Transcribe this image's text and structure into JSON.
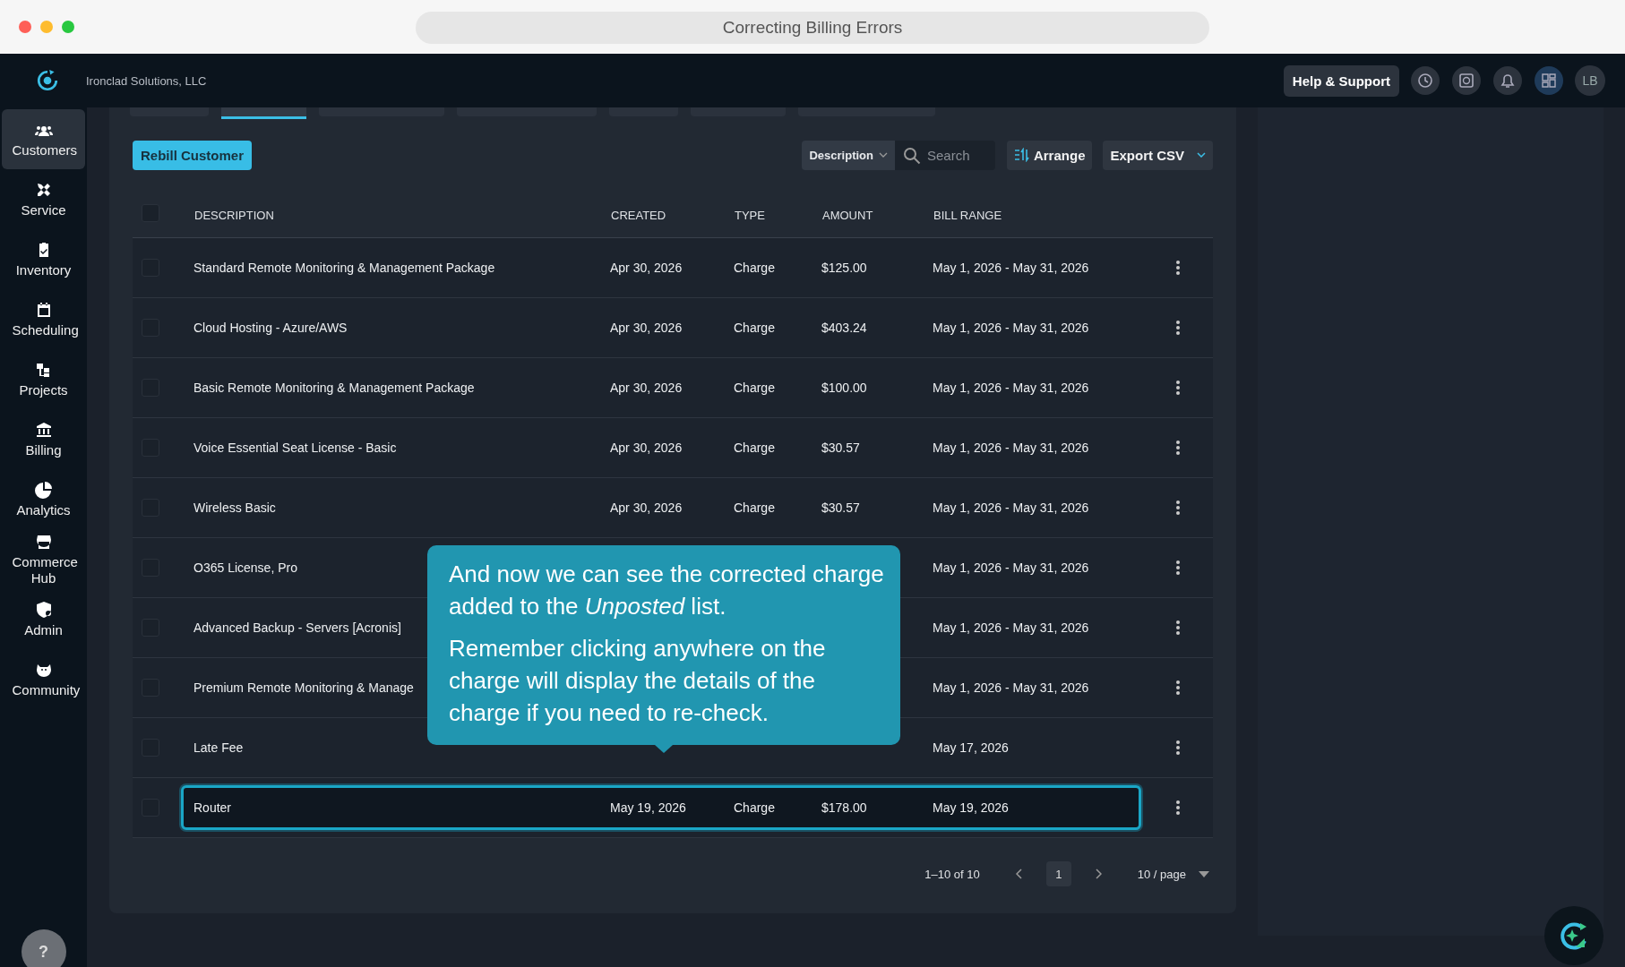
{
  "window": {
    "title": "Correcting Billing Errors"
  },
  "topbar": {
    "company": "Ironclad Solutions, LLC",
    "help_button": "Help & Support",
    "avatar": "LB"
  },
  "sidebar": {
    "items": [
      {
        "label": "Customers",
        "selected": true
      },
      {
        "label": "Service",
        "selected": false
      },
      {
        "label": "Inventory",
        "selected": false
      },
      {
        "label": "Scheduling",
        "selected": false
      },
      {
        "label": "Projects",
        "selected": false
      },
      {
        "label": "Billing",
        "selected": false
      },
      {
        "label": "Analytics",
        "selected": false
      },
      {
        "label": "Commerce Hub",
        "selected": false
      },
      {
        "label": "Admin",
        "selected": false
      },
      {
        "label": "Community",
        "selected": false
      }
    ],
    "help": "?"
  },
  "tabs": [
    {
      "selected": false
    },
    {
      "selected": true
    },
    {
      "selected": false
    },
    {
      "selected": false
    },
    {
      "selected": false
    },
    {
      "selected": false
    },
    {
      "selected": false
    }
  ],
  "toolbar": {
    "primary_button": "Rebill Customer",
    "filter_field": "Description",
    "search": {
      "placeholder": "Search"
    },
    "arrange_button": "Arrange",
    "export_button": "Export CSV"
  },
  "table": {
    "select_all": {
      "checked": false
    },
    "columns": [
      "DESCRIPTION",
      "CREATED",
      "TYPE",
      "AMOUNT",
      "BILL RANGE"
    ],
    "rows": [
      {
        "checked": false,
        "highlighted": false,
        "description": "Standard Remote Monitoring & Management Package",
        "created": "Apr 30, 2026",
        "type": "Charge",
        "amount": "$125.00",
        "bill_range": "May 1, 2026 - May 31, 2026"
      },
      {
        "checked": false,
        "highlighted": false,
        "description": "Cloud Hosting - Azure/AWS",
        "created": "Apr 30, 2026",
        "type": "Charge",
        "amount": "$403.24",
        "bill_range": "May 1, 2026 - May 31, 2026"
      },
      {
        "checked": false,
        "highlighted": false,
        "description": "Basic Remote Monitoring & Management Package",
        "created": "Apr 30, 2026",
        "type": "Charge",
        "amount": "$100.00",
        "bill_range": "May 1, 2026 - May 31, 2026"
      },
      {
        "checked": false,
        "highlighted": false,
        "description": "Voice Essential Seat License - Basic",
        "created": "Apr 30, 2026",
        "type": "Charge",
        "amount": "$30.57",
        "bill_range": "May 1, 2026 - May 31, 2026"
      },
      {
        "checked": false,
        "highlighted": false,
        "description": "Wireless Basic",
        "created": "Apr 30, 2026",
        "type": "Charge",
        "amount": "$30.57",
        "bill_range": "May 1, 2026 - May 31, 2026"
      },
      {
        "checked": false,
        "highlighted": false,
        "description": "O365 License, Pro",
        "bill_range": "May 1, 2026 - May 31, 2026"
      },
      {
        "checked": false,
        "highlighted": false,
        "description": "Advanced Backup - Servers [Acronis]",
        "bill_range": "May 1, 2026 - May 31, 2026"
      },
      {
        "checked": false,
        "highlighted": false,
        "description": "Premium Remote Monitoring & Manage",
        "bill_range": "May 1, 2026 - May 31, 2026"
      },
      {
        "checked": false,
        "highlighted": false,
        "description": "Late Fee",
        "bill_range": "May 17, 2026"
      },
      {
        "checked": false,
        "highlighted": true,
        "description": "Router",
        "created": "May 19, 2026",
        "type": "Charge",
        "amount": "$178.00",
        "bill_range": "May 19, 2026"
      }
    ]
  },
  "pagination": {
    "range": "1–10 of 10",
    "page": "1",
    "page_size": "10 / page"
  },
  "tooltip": {
    "paragraphs": [
      "And now we can see the corrected charge added to the *Unposted* list.",
      "Remember clicking anywhere on the charge will display the details of the charge if you need to re-check."
    ]
  }
}
